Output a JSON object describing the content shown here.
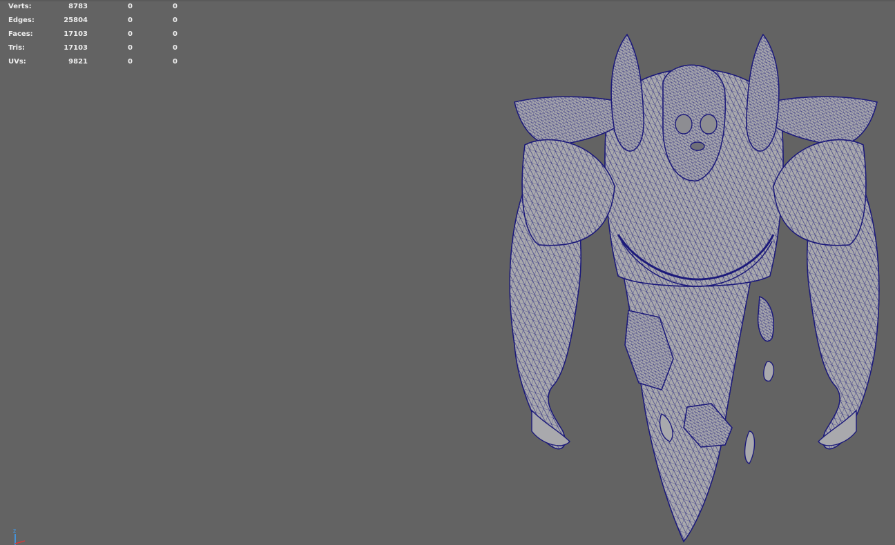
{
  "hud": {
    "rows": [
      {
        "label": "Verts:",
        "v1": "8783",
        "v2": "0",
        "v3": "0"
      },
      {
        "label": "Edges:",
        "v1": "25804",
        "v2": "0",
        "v3": "0"
      },
      {
        "label": "Faces:",
        "v1": "17103",
        "v2": "0",
        "v3": "0"
      },
      {
        "label": "Tris:",
        "v1": "17103",
        "v2": "0",
        "v3": "0"
      },
      {
        "label": "UVs:",
        "v1": "9821",
        "v2": "0",
        "v3": "0"
      }
    ]
  },
  "axis": {
    "z_label": "z"
  },
  "colors": {
    "viewport_bg": "#636363",
    "mesh_fill": "#a9a9ad",
    "wireframe": "#1c1a7a",
    "hud_text": "#eeeeee"
  }
}
